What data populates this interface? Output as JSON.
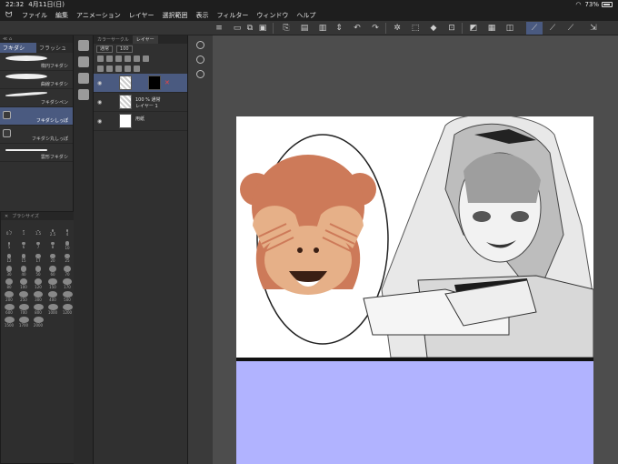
{
  "status": {
    "time": "22:32",
    "date": "4月11日(日)",
    "battery": "73%"
  },
  "menu": {
    "items": [
      "ファイル",
      "編集",
      "アニメーション",
      "レイヤー",
      "選択範囲",
      "表示",
      "フィルター",
      "ウィンドウ",
      "ヘルプ"
    ]
  },
  "brush_panel": {
    "tabs": [
      "フキダシ",
      "フラッシュ"
    ],
    "items": [
      "楕円フキダシ",
      "曲線フキダシ",
      "フキダシペン",
      "フキダシしっぽ",
      "フキダシ丸しっぽ",
      "雲形フキダシ"
    ],
    "active_index": 3
  },
  "brush_size": {
    "title": "ブラシサイズ",
    "sizes": [
      "0.7",
      "1",
      "1.5",
      "2.5",
      "4",
      "5",
      "6",
      "7",
      "8",
      "10",
      "12",
      "15",
      "17",
      "20",
      "25",
      "30",
      "40",
      "50",
      "60",
      "70",
      "80",
      "100",
      "120",
      "150",
      "170",
      "200",
      "250",
      "300",
      "400",
      "500",
      "600",
      "700",
      "800",
      "1000",
      "1200",
      "1500",
      "1700",
      "2000"
    ]
  },
  "layer_panel": {
    "tabs": [
      "カラーサークル",
      "レイヤー"
    ],
    "blend_mode": "通常",
    "opacity": "100",
    "layers": [
      {
        "line1": "",
        "line2": "",
        "type": "mask"
      },
      {
        "line1": "100 % 通常",
        "line2": "レイヤー 1",
        "type": "raster"
      },
      {
        "line1": "用紙",
        "line2": "",
        "type": "paper"
      }
    ]
  },
  "colors": {
    "accent": "#4a5a80",
    "lavender": "#b1b3ff",
    "monkey": "#cd7a59",
    "monkey_face": "#e6b088"
  }
}
